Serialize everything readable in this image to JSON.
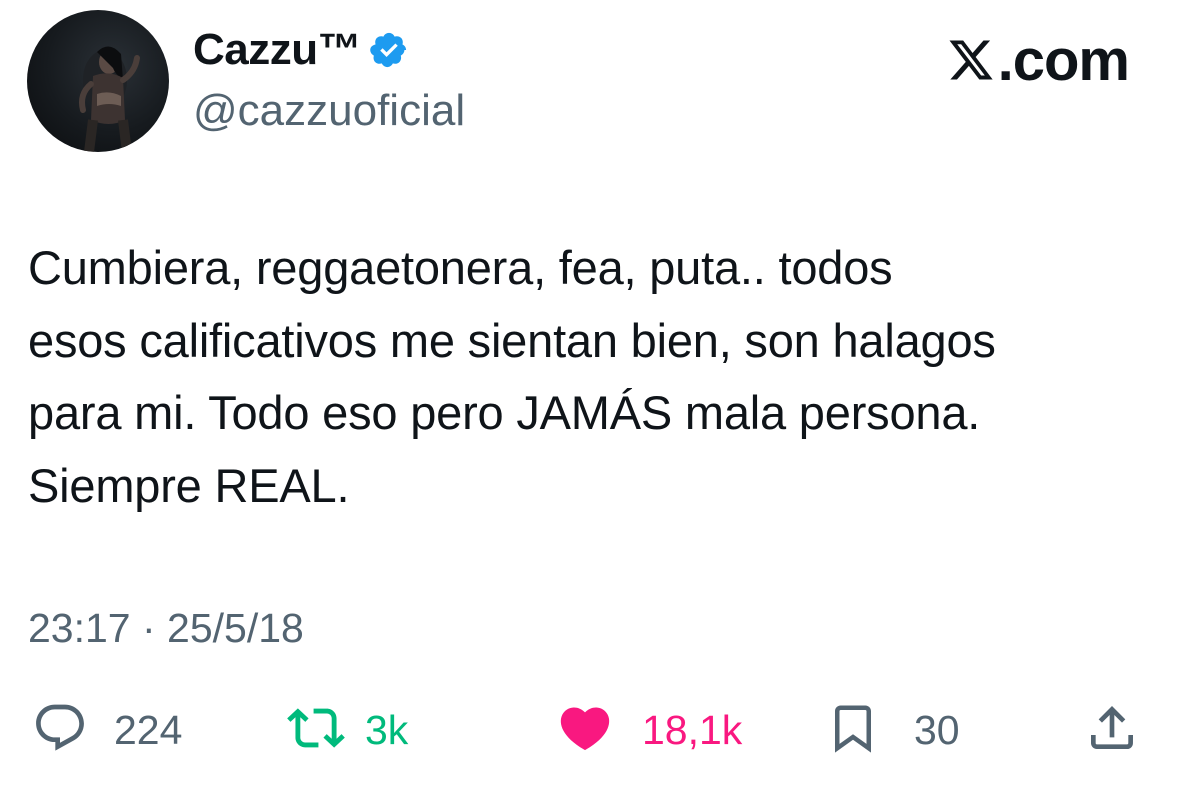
{
  "author": {
    "display_name": "Cazzu™",
    "handle": "@cazzuoficial",
    "verified": true
  },
  "brand": {
    "label": ".com",
    "icon": "x-logo-icon"
  },
  "tweet": {
    "text": "Cumbiera, reggaetonera, fea, puta.. todos esos calificativos me sientan bien, son halagos para mi. Todo eso pero JAMÁS mala persona. Siempre REAL.",
    "lines": [
      "Cumbiera, reggaetonera, fea, puta.. todos",
      "esos calificativos me sientan bien, son halagos",
      "para mi. Todo eso pero JAMÁS mala persona.",
      "Siempre REAL."
    ],
    "timestamp": "23:17 · 25/5/18"
  },
  "actions": {
    "reply": {
      "icon": "reply-icon",
      "count": "224"
    },
    "retweet": {
      "icon": "retweet-icon",
      "count": "3k"
    },
    "like": {
      "icon": "heart-icon",
      "count": "18,1k"
    },
    "bookmark": {
      "icon": "bookmark-icon",
      "count": "30"
    },
    "share": {
      "icon": "share-icon"
    }
  },
  "colors": {
    "text": "#0f1419",
    "secondary": "#536471",
    "verified": "#1d9bf0",
    "retweet": "#00ba7c",
    "like": "#f91880"
  }
}
